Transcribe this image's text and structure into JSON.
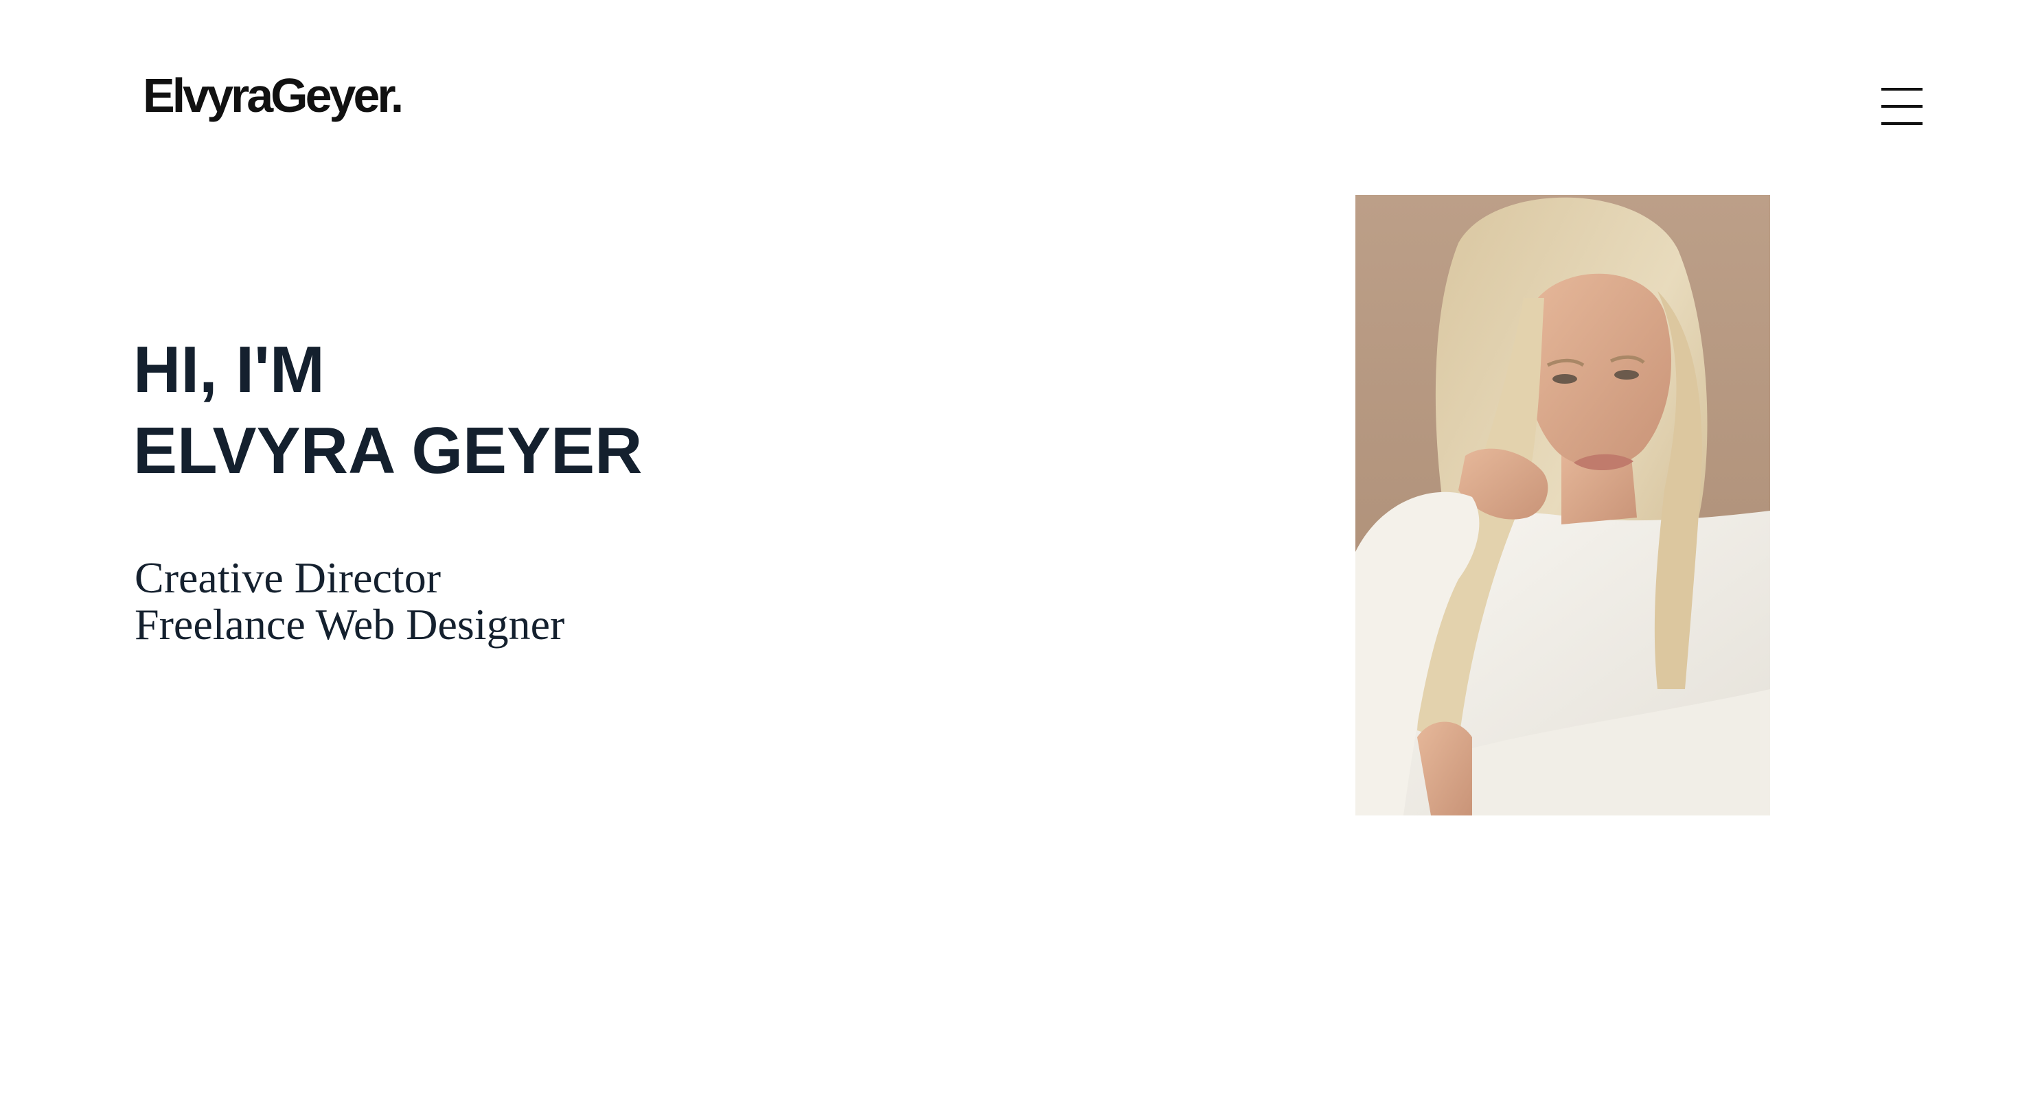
{
  "header": {
    "logo_text": "ElvyraGeyer.",
    "menu_icon": "hamburger-menu-icon"
  },
  "hero": {
    "greeting": "HI, I'M",
    "name": "ELVYRA GEYER",
    "roles": [
      "Creative Director",
      "Freelance Web Designer"
    ]
  },
  "portrait": {
    "alt": "Portrait of Elvyra Geyer"
  },
  "colors": {
    "background": "#ffffff",
    "heading": "#14202e",
    "logo": "#111111",
    "portrait_background": "#b89a83"
  }
}
